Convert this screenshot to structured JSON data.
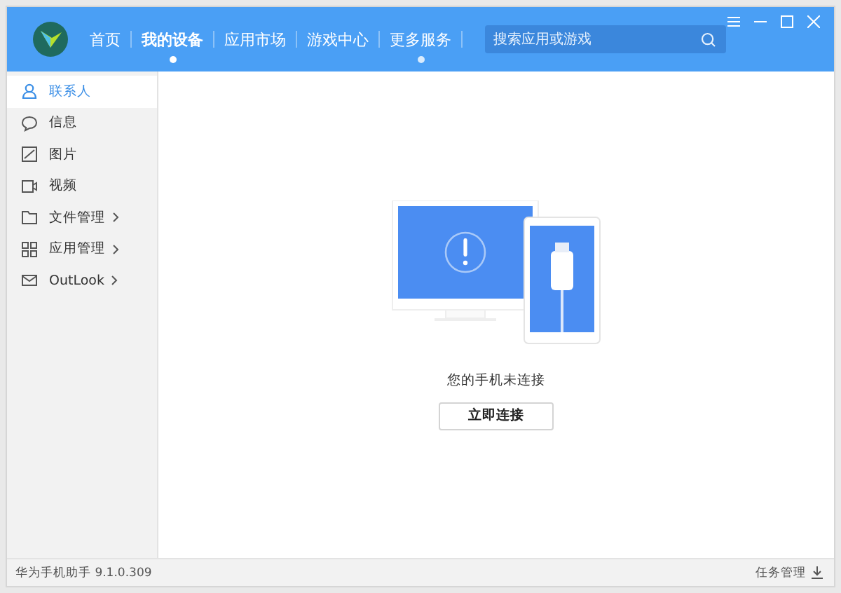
{
  "header": {
    "nav": [
      {
        "label": "首页",
        "selected": false,
        "dot": false
      },
      {
        "label": "我的设备",
        "selected": true,
        "dot": true
      },
      {
        "label": "应用市场",
        "selected": false,
        "dot": false
      },
      {
        "label": "游戏中心",
        "selected": false,
        "dot": false
      },
      {
        "label": "更多服务",
        "selected": false,
        "dot": true
      }
    ],
    "search": {
      "placeholder": "搜索应用或游戏"
    }
  },
  "sidebar": {
    "items": [
      {
        "label": "联系人",
        "kind": "contacts",
        "selected": true,
        "expandable": false
      },
      {
        "label": "信息",
        "kind": "messages",
        "selected": false,
        "expandable": false
      },
      {
        "label": "图片",
        "kind": "pictures",
        "selected": false,
        "expandable": false
      },
      {
        "label": "视频",
        "kind": "videos",
        "selected": false,
        "expandable": false
      },
      {
        "label": "文件管理",
        "kind": "files",
        "selected": false,
        "expandable": true
      },
      {
        "label": "应用管理",
        "kind": "apps",
        "selected": false,
        "expandable": true
      },
      {
        "label": "OutLook",
        "kind": "mail",
        "selected": false,
        "expandable": true
      }
    ]
  },
  "main": {
    "message": "您的手机未连接",
    "connect_button": "立即连接"
  },
  "status_bar": {
    "version": "华为手机助手 9.1.0.309",
    "task_manager": "任务管理"
  }
}
